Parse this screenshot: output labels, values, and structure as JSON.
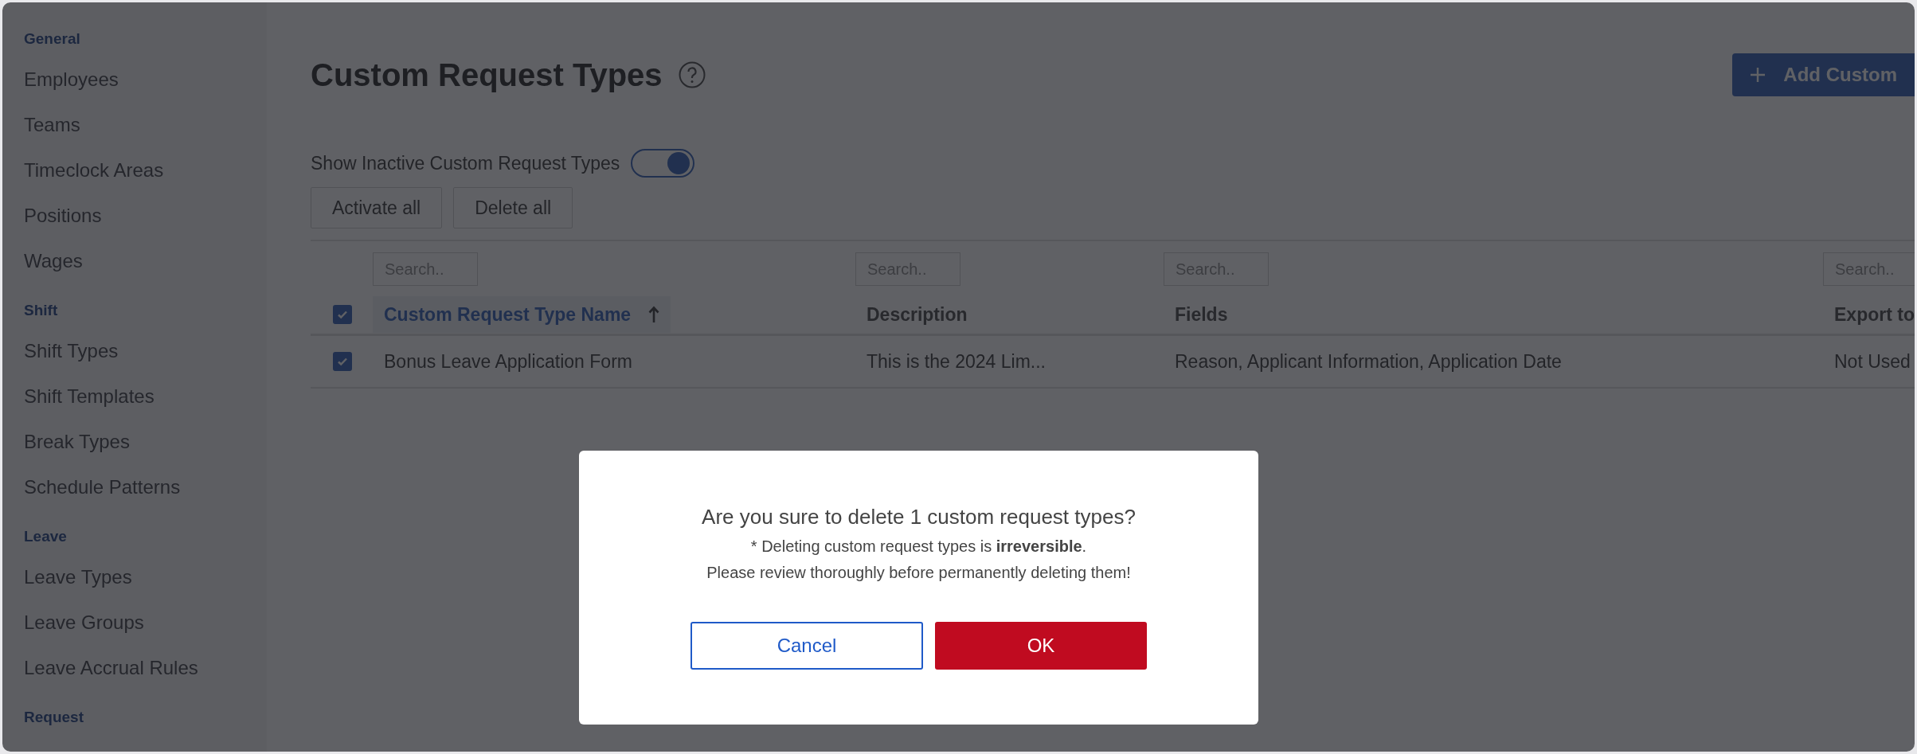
{
  "sidebar": {
    "sections": [
      {
        "title": "General",
        "items": [
          {
            "label": "Employees"
          },
          {
            "label": "Teams"
          },
          {
            "label": "Timeclock Areas"
          },
          {
            "label": "Positions"
          },
          {
            "label": "Wages"
          }
        ]
      },
      {
        "title": "Shift",
        "items": [
          {
            "label": "Shift Types"
          },
          {
            "label": "Shift Templates"
          },
          {
            "label": "Break Types"
          },
          {
            "label": "Schedule Patterns"
          }
        ]
      },
      {
        "title": "Leave",
        "items": [
          {
            "label": "Leave Types"
          },
          {
            "label": "Leave Groups"
          },
          {
            "label": "Leave Accrual Rules"
          }
        ]
      },
      {
        "title": "Request"
      }
    ]
  },
  "page": {
    "title": "Custom Request Types",
    "add_button": "Add Custom"
  },
  "toggle": {
    "label": "Show Inactive Custom Request Types",
    "on": true
  },
  "actions": [
    "Activate all",
    "Delete all"
  ],
  "table": {
    "all_checked": true,
    "columns": [
      {
        "label": "Custom Request Type Name",
        "placeholder": "Search..",
        "sorted": true
      },
      {
        "label": "Description",
        "placeholder": "Search..",
        "sorted": false
      },
      {
        "label": "Fields",
        "placeholder": "Search..",
        "sorted": false
      },
      {
        "label": "Export to",
        "placeholder": "Search..",
        "sorted": false
      }
    ],
    "rows": [
      {
        "checked": true,
        "cells": [
          "Bonus Leave Application Form",
          "This is the 2024 Lim...",
          "Reason, Applicant Information, Application Date",
          "Not Used"
        ]
      }
    ]
  },
  "dialog": {
    "title": "Are you sure to delete 1 custom request types?",
    "lines": [
      "* Deleting custom request types is **irreversible**.",
      "Please review thoroughly before permanently deleting them!"
    ],
    "cancel": "Cancel",
    "ok": "OK"
  }
}
